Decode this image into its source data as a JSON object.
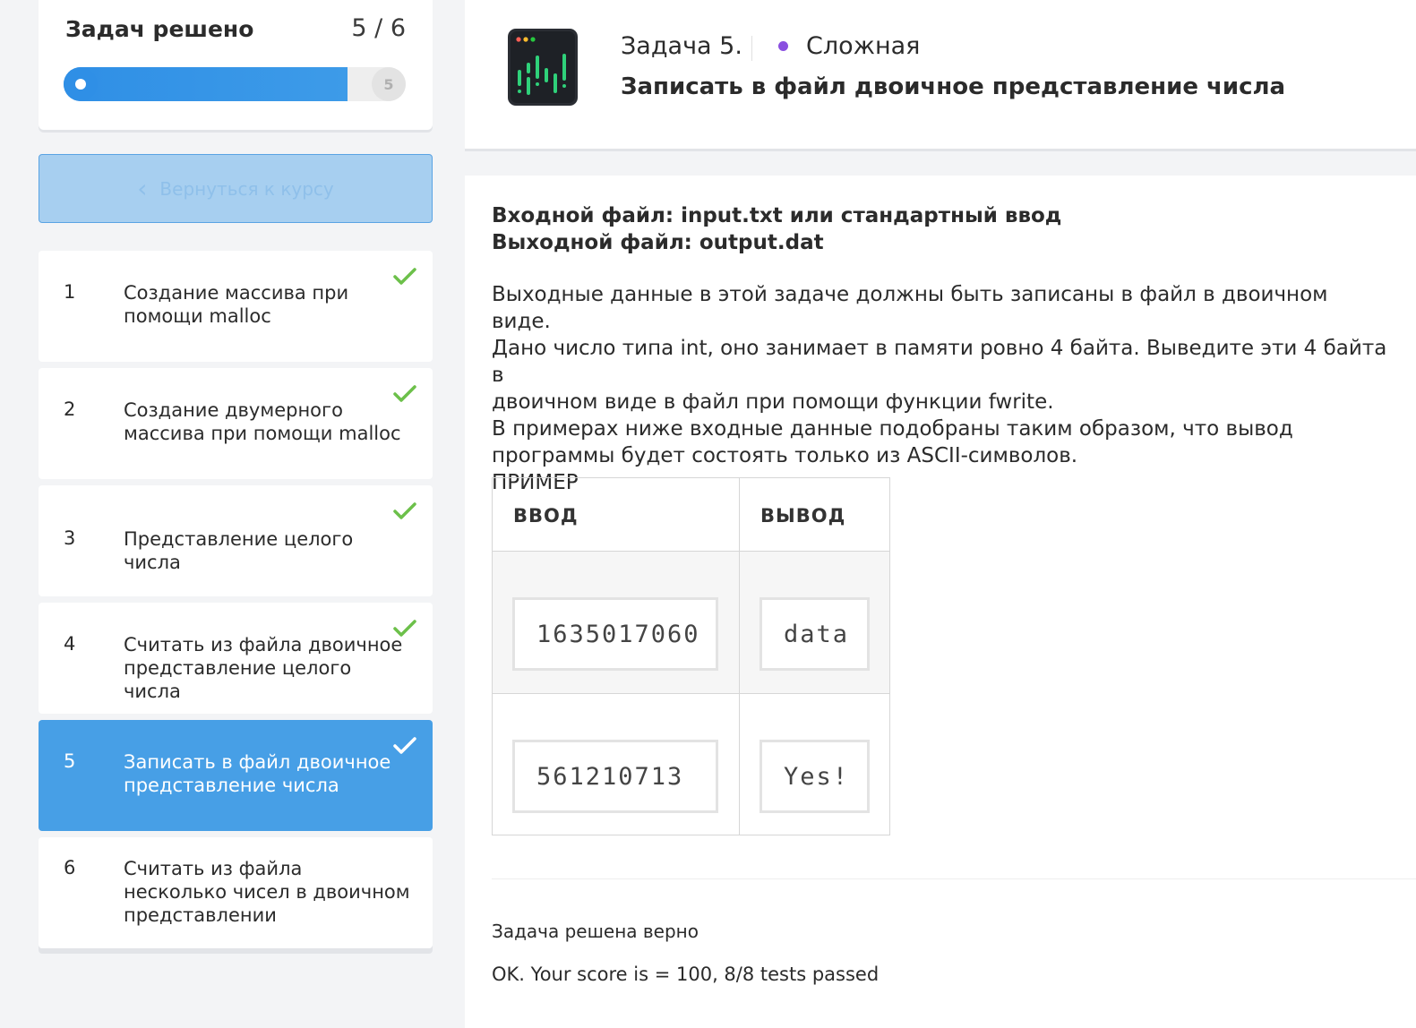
{
  "progress": {
    "title": "Задач решено",
    "count": "5 / 6",
    "fraction": 0.83,
    "end_marker": "5"
  },
  "back_button": {
    "label": "Вернуться к курсу"
  },
  "tasks": [
    {
      "num": "1",
      "title": "Создание массива при помощи malloc",
      "done": true
    },
    {
      "num": "2",
      "title": "Создание двумерного массива при помощи malloc",
      "done": true
    },
    {
      "num": "3",
      "title": "Представление целого числа",
      "done": true
    },
    {
      "num": "4",
      "title": "Считать из файла двоичное представление целого числа",
      "done": true
    },
    {
      "num": "5",
      "title": "Записать в файл двоичное представление числа",
      "done": true,
      "active": true
    },
    {
      "num": "6",
      "title": "Считать из файла несколько чисел в двоичном представлении",
      "done": false
    }
  ],
  "header": {
    "task_label": "Задача 5.",
    "difficulty": "Сложная",
    "difficulty_color": "#8a4fe0",
    "title": "Записать в файл двоичное представление числа",
    "icon": "terminal-chart-icon"
  },
  "content": {
    "input_file": "Входной файл: input.txt или стандартный ввод",
    "output_file": "Выходной файл: output.dat",
    "description": [
      "Выходные данные в этой задаче должны быть записаны в файл в двоичном виде.",
      "Дано число типа int, оно занимает в памяти ровно 4 байта. Выведите эти 4 байта в",
      "двоичном виде в файл при помощи функции fwrite.",
      "В примерах ниже входные данные подобраны таким образом, что вывод",
      "программы будет состоять только из ASCII-символов.",
      "ПРИМЕР"
    ]
  },
  "example": {
    "col_input": "ВВОД",
    "col_output": "ВЫВОД",
    "rows": [
      {
        "input": "1635017060",
        "output": "data"
      },
      {
        "input": "561210713",
        "output": "Yes!"
      }
    ]
  },
  "result": {
    "status": "Задача решена верно",
    "score": "OK. Your score is = 100, 8/8 tests passed"
  },
  "colors": {
    "accent": "#479fe6",
    "check": "#6cc04a",
    "progress": "#2f8fe6"
  }
}
